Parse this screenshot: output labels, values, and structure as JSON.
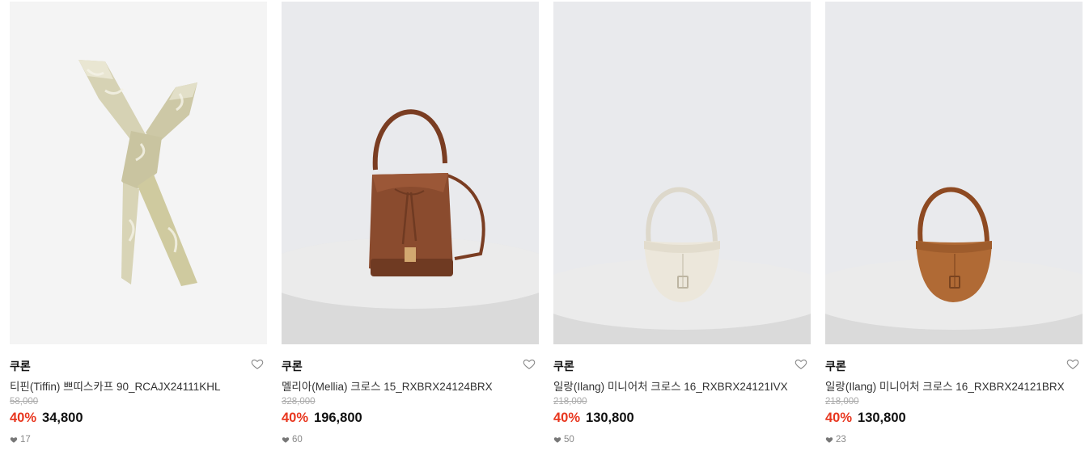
{
  "products": [
    {
      "brand": "쿠론",
      "name": "티핀(Tiffin) 쁘띠스카프 90_RCAJX24111KHL",
      "original_price": "58,000",
      "discount": "40%",
      "price": "34,800",
      "likes": "17",
      "image_icon": "scarf-image",
      "image_bg": "#f3f3f3"
    },
    {
      "brand": "쿠론",
      "name": "멜리아(Mellia) 크로스 15_RXBRX24124BRX",
      "original_price": "328,000",
      "discount": "40%",
      "price": "196,800",
      "likes": "60",
      "image_icon": "bucket-bag-image",
      "image_bg": "#e9eaed"
    },
    {
      "brand": "쿠론",
      "name": "일랑(Ilang) 미니어처 크로스 16_RXBRX24121IVX",
      "original_price": "218,000",
      "discount": "40%",
      "price": "130,800",
      "likes": "50",
      "image_icon": "hobo-bag-ivory-image",
      "image_bg": "#e9eaed"
    },
    {
      "brand": "쿠론",
      "name": "일랑(Ilang) 미니어처 크로스 16_RXBRX24121BRX",
      "original_price": "218,000",
      "discount": "40%",
      "price": "130,800",
      "likes": "23",
      "image_icon": "hobo-bag-brown-image",
      "image_bg": "#e9eaed"
    }
  ],
  "colors": {
    "discount": "#e8361e",
    "strike_price": "#aaaaaa",
    "brand_brown": "#8a4b2e"
  }
}
